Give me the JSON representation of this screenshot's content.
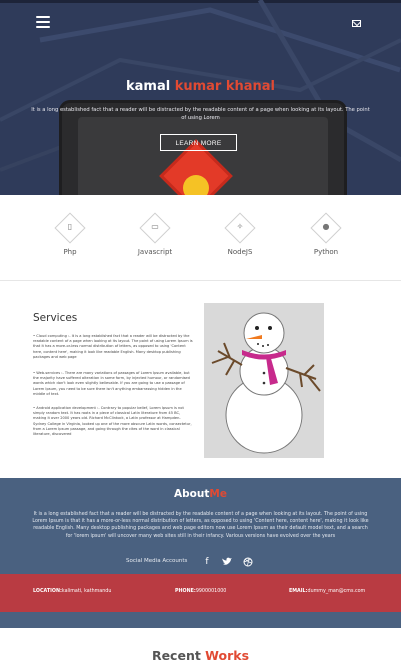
{
  "hero": {
    "title_main": "kamal ",
    "title_highlight": "kumar khanal",
    "subtitle": "It is a long established fact that a reader will be distracted by the readable content of a page when looking at its layout. The point of using Lorem",
    "button_label": "LEARN MORE"
  },
  "skills": [
    {
      "label": "Php",
      "icon": "phone-icon",
      "glyph": "▯"
    },
    {
      "label": "Javascript",
      "icon": "monitor-icon",
      "glyph": "▭"
    },
    {
      "label": "NodeJS",
      "icon": "magic-wand-icon",
      "glyph": "✧"
    },
    {
      "label": "Python",
      "icon": "apple-icon",
      "glyph": "●"
    }
  ],
  "services": {
    "title": "Services",
    "items": [
      "• Cloud computing :- It is a long established fact that a reader will be distracted by the readable content of a page when looking at its layout. The point of using Lorem Ipsum is that it has a more-or-less normal distribution of letters, as opposed to using 'Content here, content here', making it look like readable English. Many desktop publishing packages and web page",
      "• Web-services :- There are many variations of passages of Lorem Ipsum available, but the majority have suffered alteration in some form, by injected humour, or randomised words which don't look even slightly believable. If you are going to use a passage of Lorem Ipsum, you need to be sure there isn't anything embarrassing hidden in the middle of text.",
      "• Android application development :- Contrary to popular belief, Lorem Ipsum is not simply random text. It has roots in a piece of classical Latin literature from 45 BC, making it over 2000 years old. Richard McClintock, a Latin professor at Hampden-Sydney College in Virginia, looked up one of the more obscure Latin words, consectetur, from a Lorem Ipsum passage, and going through the cites of the word in classical literature, discovered"
    ]
  },
  "about": {
    "title_main": "About",
    "title_highlight": "Me",
    "text": "It is a long established fact that a reader will be distracted by the readable content of a page when looking at its layout. The point of using Lorem Ipsum is that it has a more-or-less normal distribution of letters, as opposed to using 'Content here, content here', making it look like readable English. Many desktop publishing packages and web page editors now use Lorem Ipsum as their default model text, and a search for 'lorem ipsum' will uncover many web sites still in their infancy. Various versions have evolved over the years",
    "social_label": "Social Media Accounts",
    "social_icons": [
      "facebook-icon",
      "twitter-icon",
      "dribbble-icon"
    ]
  },
  "contact": {
    "location_label": "LOCATION:",
    "location_value": "kalimati, kathmandu",
    "phone_label": "PHONE:",
    "phone_value": "9900001000",
    "email_label": "EMAIL:",
    "email_value": "dummy_man@cms.com"
  },
  "recent": {
    "title_main": "Recent ",
    "title_highlight": "Works"
  },
  "colors": {
    "hero_bg": "#2f3b5a",
    "accent": "#e14a33",
    "about_bg": "#4a6180",
    "contact_bg": "#b93b42"
  }
}
